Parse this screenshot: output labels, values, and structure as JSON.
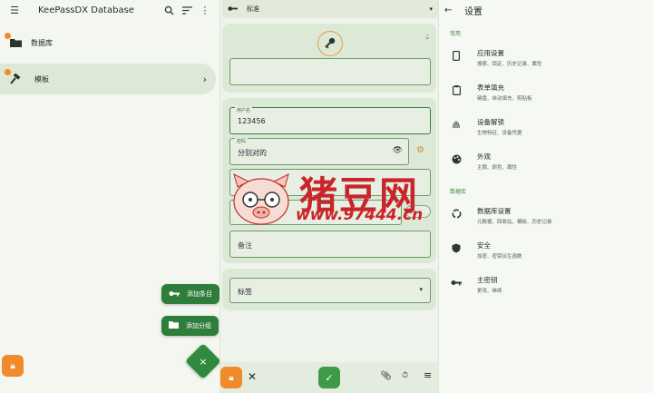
{
  "left": {
    "title": "KeePassDX Database",
    "groups": [
      {
        "label": "数据库",
        "selected": false
      },
      {
        "label": "模板",
        "selected": true
      }
    ],
    "add_entry": "添加条目",
    "add_group": "添加分组",
    "fab_close": "×"
  },
  "middle": {
    "template_label": "标准",
    "title_value": "",
    "username_label": "用户名",
    "username_value": "123456",
    "password_label": "密码",
    "password_value": "分别对的",
    "url_label": "网址",
    "notes_placeholder": "备注",
    "tags_label": "标签"
  },
  "right": {
    "title": "设置",
    "section_general": "常用",
    "section_database": "数据库",
    "general_items": [
      {
        "title": "应用设置",
        "subtitle": "搜索、锁定、历史记录、属性",
        "icon": "phone-icon"
      },
      {
        "title": "表单填充",
        "subtitle": "键盘、自动填充、剪贴板",
        "icon": "clipboard-icon"
      },
      {
        "title": "设备解锁",
        "subtitle": "生物特征、设备凭据",
        "icon": "fingerprint-icon"
      },
      {
        "title": "外观",
        "subtitle": "主题、颜色、属性",
        "icon": "palette-icon"
      }
    ],
    "database_items": [
      {
        "title": "数据库设置",
        "subtitle": "元数据、回收站、模板、历史记录",
        "icon": "database-settings-icon"
      },
      {
        "title": "安全",
        "subtitle": "加密、密钥派生函数",
        "icon": "shield-icon"
      },
      {
        "title": "主密钥",
        "subtitle": "更改、继续",
        "icon": "key-icon"
      }
    ]
  },
  "watermark": {
    "name": "猪豆网",
    "url": "www.97444.cn"
  },
  "colors": {
    "accent_green": "#2f7d3a",
    "lock_orange": "#f08a2a",
    "watermark_red": "#c9252a"
  }
}
